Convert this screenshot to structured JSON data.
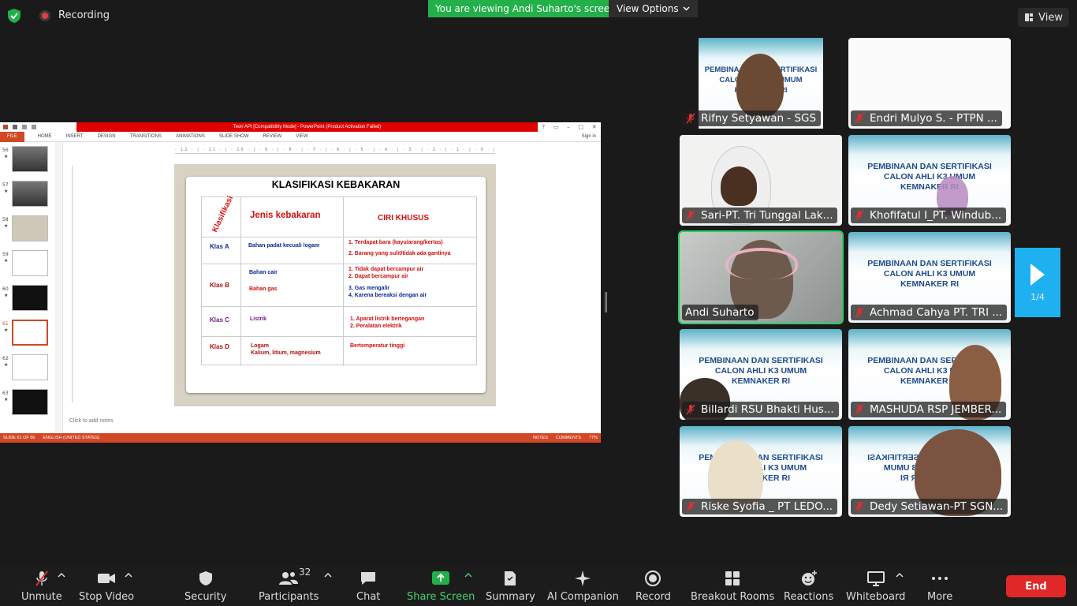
{
  "topbar": {
    "recording_label": "Recording",
    "viewing_banner": "You are viewing Andi Suharto's screen",
    "view_options_label": "View Options",
    "view_label": "View"
  },
  "shared_screen": {
    "window_title": "Teori API [Compatibility Mode] - PowerPoint (Product Activation Failed)",
    "ribbon_tabs": [
      "FILE",
      "HOME",
      "INSERT",
      "DESIGN",
      "TRANSITIONS",
      "ANIMATIONS",
      "SLIDE SHOW",
      "REVIEW",
      "VIEW"
    ],
    "sign_in": "Sign in",
    "thumbnails": [
      {
        "num": "56",
        "star": "★"
      },
      {
        "num": "57",
        "star": "★"
      },
      {
        "num": "58",
        "star": "★"
      },
      {
        "num": "59",
        "star": "★"
      },
      {
        "num": "60",
        "star": "★"
      },
      {
        "num": "61",
        "star": "★"
      },
      {
        "num": "62",
        "star": "★"
      },
      {
        "num": "63",
        "star": "★"
      }
    ],
    "ruler": "· 12 · | · 11 · | · 10 · | · 9 · | · 8 · | · 7 · | · 6 · | · 5 · | · 4 · | · 3 · | · 2 · | · 1 · | · 0 · | · 1 · | · 2 · | · 3 · | · 4 · | · 5 · | · 6 · | · 7 · | · 8 · | · 9 · | · 10 · | · 11 · | · 12",
    "slide": {
      "title": "KLASIFIKASI KEBAKARAN",
      "header_klasifikasi": "Klasifikasi",
      "header_jenis": "Jenis kebakaran",
      "header_ciri": "CIRI KHUSUS",
      "rows": [
        {
          "klas": "Klas A",
          "jenis": "Bahan padat kecuali logam",
          "ciri1": "1. Terdapat bara (kayu/arang/kertas)",
          "ciri2": "2. Barang yang sulit/tidak ada gantinya"
        },
        {
          "klas": "Klas B",
          "jenis1": "Bahan cair",
          "jenis2": "Bahan gas",
          "ciri1": "1. Tidak dapat bercampur air",
          "ciri2": "2. Dapat bercampur air",
          "ciri3": "3. Gas mengalir",
          "ciri4": "4. Karena bereaksi dengan air"
        },
        {
          "klas": "Klas C",
          "jenis": "Listrik",
          "ciri1": "1. Aparat listrik bertegangan",
          "ciri2": "2. Peralatan elektrik"
        },
        {
          "klas": "Klas D",
          "jenis1": "Logam",
          "jenis2": "Kalium, litium, magnesium",
          "ciri1": "Bertemperatur tinggi"
        }
      ]
    },
    "notes_placeholder": "Click to add notes",
    "status": {
      "slide_of": "SLIDE 61 OF 66",
      "language": "ENGLISH (UNITED STATES)",
      "notes": "NOTES",
      "comments": "COMMENTS",
      "zoom": "77%"
    }
  },
  "gallery": {
    "banner_line1": "PEMBINAAN DAN SERTIFIKASI",
    "banner_line2": "CALON AHLI K3 UMUM",
    "banner_line3": "KEMNAKER RI",
    "participants": [
      {
        "name": "Rifny Setyawan - SGS"
      },
      {
        "name": "Endri Mulyo S.  - PTPN ..."
      },
      {
        "name": "Sari-PT. Tri Tunggal Lak..."
      },
      {
        "name": "Khofifatul I_PT. Windub..."
      },
      {
        "name": "Andi Suharto"
      },
      {
        "name": "Achmad Cahya PT. TRI ..."
      },
      {
        "name": "Billardi RSU Bhakti Hus..."
      },
      {
        "name": "MASHUDA RSP JEMBER..."
      },
      {
        "name": "Riske Syofia _ PT LEDO..."
      },
      {
        "name": "Dedy Setiawan-PT SGN..."
      }
    ],
    "page_indicator": "1/4"
  },
  "toolbar": {
    "unmute": "Unmute",
    "stop_video": "Stop Video",
    "security": "Security",
    "participants": "Participants",
    "participants_count": "32",
    "chat": "Chat",
    "share_screen": "Share Screen",
    "summary": "Summary",
    "ai_companion": "AI Companion",
    "record": "Record",
    "breakout_rooms": "Breakout Rooms",
    "reactions": "Reactions",
    "whiteboard": "Whiteboard",
    "more": "More",
    "end": "End"
  },
  "colors": {
    "accent_green": "#23b04a",
    "end_red": "#e02828",
    "ppt_orange": "#d24726",
    "next_blue": "#1fb0f0"
  }
}
